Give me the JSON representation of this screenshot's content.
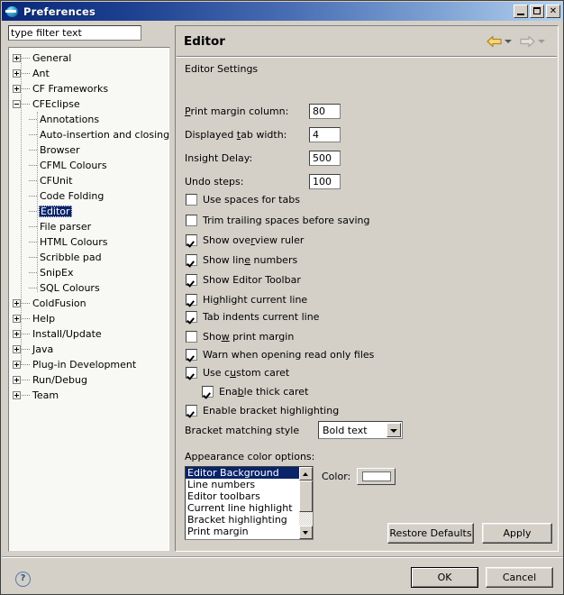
{
  "window": {
    "title": "Preferences",
    "icon": "eclipse-icon",
    "controls": {
      "minimize": "_",
      "maximize": "□",
      "close": "✕"
    }
  },
  "sidebar": {
    "filter_value": "type filter text",
    "filter_placeholder": "type filter text",
    "items": [
      {
        "label": "General",
        "level": 0,
        "toggle": "plus"
      },
      {
        "label": "Ant",
        "level": 0,
        "toggle": "plus"
      },
      {
        "label": "CF Frameworks",
        "level": 0,
        "toggle": "plus"
      },
      {
        "label": "CFEclipse",
        "level": 0,
        "toggle": "minus"
      },
      {
        "label": "Annotations",
        "level": 1,
        "toggle": "none"
      },
      {
        "label": "Auto-insertion and closing",
        "level": 1,
        "toggle": "none"
      },
      {
        "label": "Browser",
        "level": 1,
        "toggle": "none"
      },
      {
        "label": "CFML Colours",
        "level": 1,
        "toggle": "none"
      },
      {
        "label": "CFUnit",
        "level": 1,
        "toggle": "none"
      },
      {
        "label": "Code Folding",
        "level": 1,
        "toggle": "none"
      },
      {
        "label": "Editor",
        "level": 1,
        "toggle": "none",
        "selected": true
      },
      {
        "label": "File parser",
        "level": 1,
        "toggle": "none"
      },
      {
        "label": "HTML Colours",
        "level": 1,
        "toggle": "none"
      },
      {
        "label": "Scribble pad",
        "level": 1,
        "toggle": "none"
      },
      {
        "label": "SnipEx",
        "level": 1,
        "toggle": "none"
      },
      {
        "label": "SQL Colours",
        "level": 1,
        "toggle": "none"
      },
      {
        "label": "ColdFusion",
        "level": 0,
        "toggle": "plus"
      },
      {
        "label": "Help",
        "level": 0,
        "toggle": "plus"
      },
      {
        "label": "Install/Update",
        "level": 0,
        "toggle": "plus"
      },
      {
        "label": "Java",
        "level": 0,
        "toggle": "plus"
      },
      {
        "label": "Plug-in Development",
        "level": 0,
        "toggle": "plus"
      },
      {
        "label": "Run/Debug",
        "level": 0,
        "toggle": "plus"
      },
      {
        "label": "Team",
        "level": 0,
        "toggle": "plus"
      }
    ]
  },
  "page": {
    "title": "Editor",
    "group_title": "Editor Settings",
    "nav": {
      "back": "back-arrow",
      "back_menu": "chevron-down-icon",
      "forward": "forward-arrow",
      "forward_menu": "chevron-down-icon"
    },
    "fields": [
      {
        "label": "Print margin column:",
        "value": "80",
        "mnemonic": "P"
      },
      {
        "label": "Displayed tab width:",
        "value": "4",
        "mnemonic": "t"
      },
      {
        "label": "Insight Delay:",
        "value": "500",
        "mnemonic": ""
      },
      {
        "label": "Undo steps:",
        "value": "100",
        "mnemonic": ""
      }
    ],
    "checkboxes": [
      {
        "label": "Use spaces for tabs",
        "checked": false,
        "indent": 0
      },
      {
        "label": "Trim trailing spaces before saving",
        "checked": false,
        "indent": 0
      },
      {
        "label": "Show overview ruler",
        "checked": true,
        "indent": 0
      },
      {
        "label": "Show line numbers",
        "checked": true,
        "indent": 0
      },
      {
        "label": "Show Editor Toolbar",
        "checked": true,
        "indent": 0
      },
      {
        "label": "Highlight current line",
        "checked": true,
        "indent": 0
      },
      {
        "label": "Tab indents current line",
        "checked": true,
        "indent": 0
      },
      {
        "label": "Show print margin",
        "checked": false,
        "indent": 0
      },
      {
        "label": "Warn when opening read only files",
        "checked": true,
        "indent": 0
      },
      {
        "label": "Use custom caret",
        "checked": true,
        "indent": 0
      },
      {
        "label": "Enable thick caret",
        "checked": true,
        "indent": 1
      },
      {
        "label": "Enable bracket highlighting",
        "checked": true,
        "indent": 0
      }
    ],
    "bracket_style": {
      "label": "Bracket matching style",
      "value": "Bold text"
    },
    "appearance": {
      "label": "Appearance color options:",
      "items": [
        "Editor Background",
        "Line numbers",
        "Editor toolbars",
        "Current line highlight",
        "Bracket highlighting",
        "Print margin"
      ],
      "selected_index": 0,
      "color_label": "Color:",
      "color_value": "#ffffff"
    },
    "buttons": {
      "restore_defaults": "Restore Defaults",
      "apply": "Apply"
    }
  },
  "footer": {
    "help": "?",
    "ok": "OK",
    "cancel": "Cancel"
  },
  "colors": {
    "dialog_bg": "#d4d0c8",
    "title_start": "#0b2878",
    "title_end": "#b6d2ef",
    "selection": "#0a246a",
    "tree_bg": "#f8f8f5"
  }
}
